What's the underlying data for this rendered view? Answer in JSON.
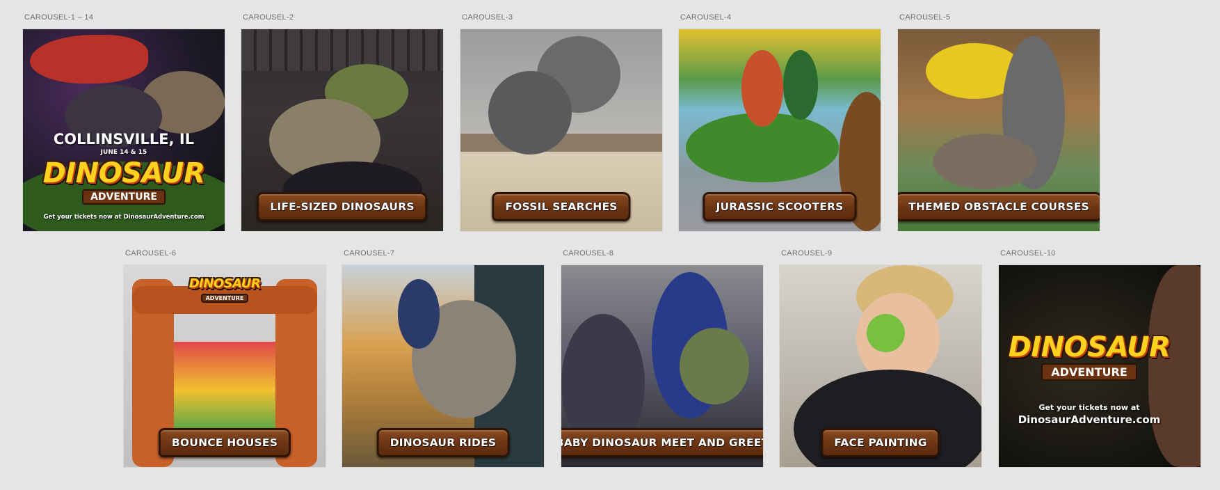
{
  "canvas": {
    "background": "#e5e5e5"
  },
  "frames": [
    {
      "id": "c1",
      "label": "CAROUSEL-1 – 14"
    },
    {
      "id": "c2",
      "label": "CAROUSEL-2",
      "caption": "LIFE-SIZED DINOSAURS"
    },
    {
      "id": "c3",
      "label": "CAROUSEL-3",
      "caption": "FOSSIL SEARCHES"
    },
    {
      "id": "c4",
      "label": "CAROUSEL-4",
      "caption": "JURASSIC SCOOTERS"
    },
    {
      "id": "c5",
      "label": "CAROUSEL-5",
      "caption": "THEMED OBSTACLE COURSES"
    },
    {
      "id": "c6",
      "label": "CAROUSEL-6",
      "caption": "BOUNCE HOUSES"
    },
    {
      "id": "c7",
      "label": "CAROUSEL-7",
      "caption": "DINOSAUR RIDES"
    },
    {
      "id": "c8",
      "label": "CAROUSEL-8",
      "caption": "BABY DINOSAUR MEET AND GREET"
    },
    {
      "id": "c9",
      "label": "CAROUSEL-9",
      "caption": "FACE PAINTING"
    },
    {
      "id": "c10",
      "label": "CAROUSEL-10"
    }
  ],
  "promo": {
    "city": "COLLINSVILLE, IL",
    "dates": "JUNE 14 & 15",
    "logo_word1": "DINOSAUR",
    "logo_word2": "ADVENTURE",
    "tickets": "Get your tickets now at DinosaurAdventure.com"
  },
  "c6_sign": {
    "word1": "DINOSAUR",
    "word2": "ADVENTURE"
  },
  "closing": {
    "logo_word1": "DINOSAUR",
    "logo_word2": "ADVENTURE",
    "tickets_line1": "Get your tickets now at",
    "tickets_line2": "DinosaurAdventure.com"
  },
  "colors": {
    "logo_yellow": "#ffd21f",
    "plank_brown": "#6d3614",
    "label_gray": "#6e6e6e"
  },
  "icons": [
    "wood-plank-sign-icon",
    "dinosaur-logo-icon"
  ]
}
